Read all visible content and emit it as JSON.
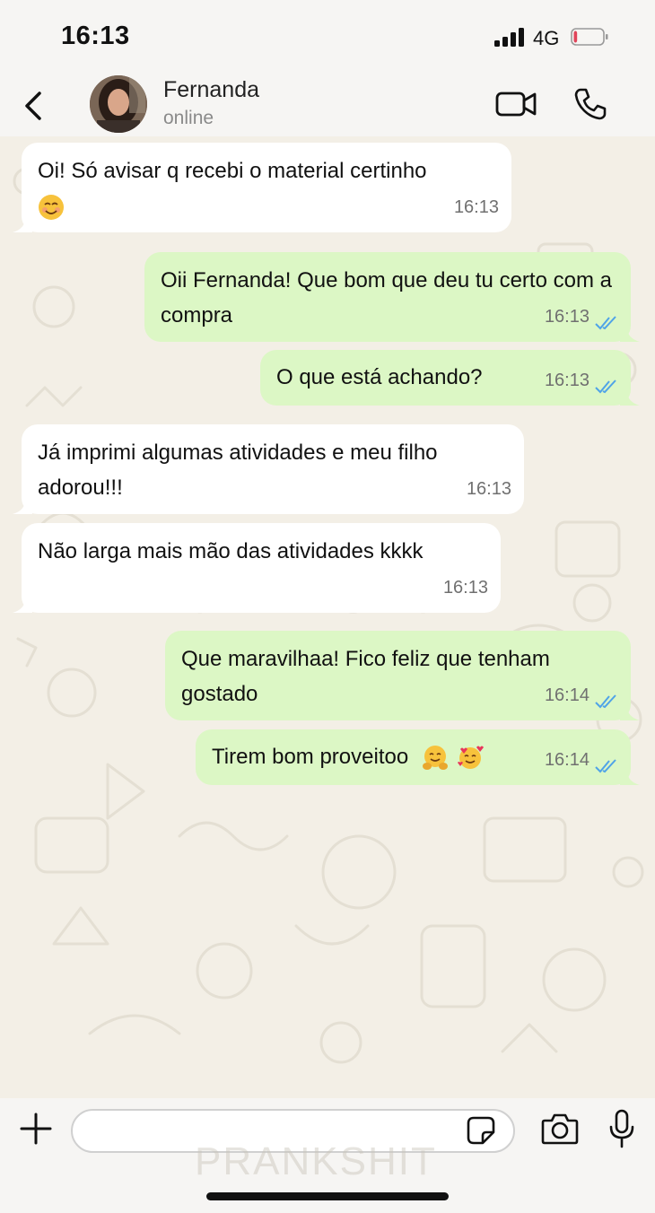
{
  "status_bar": {
    "time": "16:13",
    "network": "4G",
    "battery_level": 0.12,
    "battery_color": "#e0445a"
  },
  "header": {
    "contact_name": "Fernanda",
    "contact_status": "online",
    "icons": [
      "back-icon",
      "video-call-icon",
      "phone-icon"
    ]
  },
  "messages": [
    {
      "direction": "in",
      "text": "Oi! Só avisar q recebi o material certinho",
      "emoji": "😊",
      "time": "16:13"
    },
    {
      "direction": "out",
      "text": "Oii Fernanda! Que bom que deu tu certo com a compra",
      "time": "16:13",
      "read": true
    },
    {
      "direction": "out",
      "text": "O que está achando?",
      "time": "16:13",
      "read": true
    },
    {
      "direction": "in",
      "text": "Já imprimi algumas atividades e meu filho adorou!!!",
      "time": "16:13"
    },
    {
      "direction": "in",
      "text": "Não larga mais mão das atividades kkkk",
      "time": "16:13"
    },
    {
      "direction": "out",
      "text": "Que maravilhaa! Fico feliz que tenham gostado",
      "time": "16:14",
      "read": true
    },
    {
      "direction": "out",
      "text": "Tirem bom proveitoo",
      "emoji": "🤗 🥰",
      "time": "16:14",
      "read": true
    }
  ],
  "watermark": "PRANKSHIT",
  "composer": {
    "placeholder": "",
    "icons": [
      "plus-icon",
      "sticker-icon",
      "camera-icon",
      "microphone-icon"
    ]
  },
  "colors": {
    "incoming_bubble": "#ffffff",
    "outgoing_bubble": "#dcf7c5",
    "read_ticks": "#4fa3e8",
    "chat_background": "#f3efe6"
  }
}
